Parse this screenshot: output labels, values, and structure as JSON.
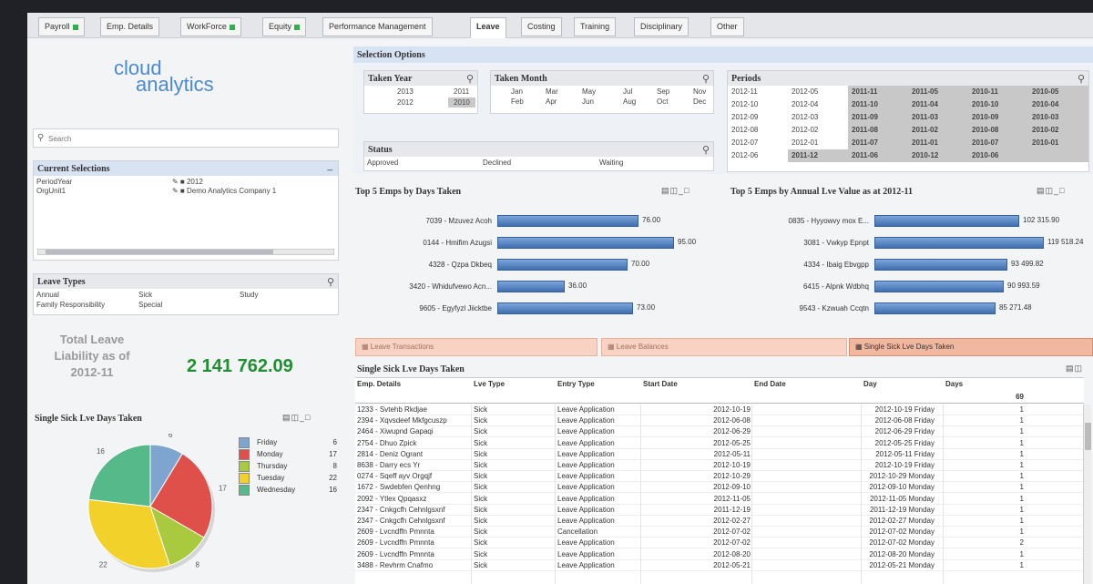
{
  "tabs": [
    {
      "label": "Payroll",
      "dot": true
    },
    {
      "label": "Emp. Details",
      "dot": false
    },
    {
      "label": "WorkForce",
      "dot": true
    },
    {
      "label": "Equity",
      "dot": true
    },
    {
      "label": "Performance Management",
      "dot": false
    },
    {
      "label": "Leave",
      "dot": false,
      "active": true
    },
    {
      "label": "Costing",
      "dot": false
    },
    {
      "label": "Training",
      "dot": false
    },
    {
      "label": "Disciplinary",
      "dot": false
    },
    {
      "label": "Other",
      "dot": false
    }
  ],
  "logo": {
    "line1": "cloud",
    "line2": "analytics"
  },
  "search": {
    "placeholder": "Search"
  },
  "current_selections": {
    "title": "Current Selections",
    "rows": [
      {
        "field": "PeriodYear",
        "value": "2012"
      },
      {
        "field": "OrgUnit1",
        "value": "Demo Analytics Company 1"
      }
    ]
  },
  "leave_types": {
    "title": "Leave Types",
    "items": [
      "Annual",
      "Sick",
      "Study",
      "Family Responsibility",
      "Special"
    ]
  },
  "liability": {
    "label_lines": [
      "Total Leave",
      "Liability as of",
      "2012-11"
    ],
    "value": "2 141 762.09"
  },
  "selection_options": {
    "title": "Selection Options",
    "taken_year": {
      "title": "Taken Year",
      "values": [
        "2013",
        "2011",
        "2012",
        "2010"
      ]
    },
    "taken_month": {
      "title": "Taken Month",
      "values": [
        "Jan",
        "Mar",
        "May",
        "Jul",
        "Sep",
        "Nov",
        "Feb",
        "Apr",
        "Jun",
        "Aug",
        "Oct",
        "Dec"
      ]
    },
    "status": {
      "title": "Status",
      "values": [
        "Approved",
        "Declined",
        "Waiting"
      ]
    },
    "periods": {
      "title": "Periods",
      "cols": [
        [
          "2012-11",
          "2012-10",
          "2012-09",
          "2012-08",
          "2012-07",
          "2012-06"
        ],
        [
          "2012-05",
          "2012-04",
          "2012-03",
          "2012-02",
          "2012-01",
          "2011-12"
        ],
        [
          "2011-11",
          "2011-10",
          "2011-09",
          "2011-08",
          "2011-07",
          "2011-06"
        ],
        [
          "2011-05",
          "2011-04",
          "2011-03",
          "2011-02",
          "2011-01",
          "2010-12"
        ],
        [
          "2010-11",
          "2010-10",
          "2010-09",
          "2010-08",
          "2010-07",
          "2010-06"
        ],
        [
          "2010-05",
          "2010-04",
          "2010-03",
          "2010-02",
          "2010-01",
          ""
        ]
      ]
    }
  },
  "top5_days": {
    "title": "Top 5 Emps by Days Taken",
    "labels": [
      "7039 - Mzuvez Acoh",
      "0144 - Hmifim Azugsi",
      "4328 - Qzpa Dkbeq",
      "3420 - Whidufvewo Acn...",
      "9605 - Egyfyzl Jiicktbe"
    ],
    "value_labels": [
      "76.00",
      "95.00",
      "70.00",
      "36.00",
      "73.00"
    ]
  },
  "top5_value": {
    "title": "Top 5 Emps by Annual Lve Value as at 2012-11",
    "labels": [
      "0835 - Hyyowvy mox E...",
      "3081 - Vwkyp Epnpt",
      "4334 - Ibaig Ebvgpp",
      "6415 - Alpnk Wdbhq",
      "9543 - Kzwuah Ccqtn"
    ],
    "value_labels": [
      "102 315.90",
      "119 518.24",
      "93 499.82",
      "90 993.59",
      "85 271.48"
    ]
  },
  "chart_data": [
    {
      "type": "bar",
      "title": "Top 5 Emps by Days Taken",
      "categories": [
        "7039 - Mzuvez Acoh",
        "0144 - Hmifim Azugsi",
        "4328 - Qzpa Dkbeq",
        "3420 - Whidufvewo Acn...",
        "9605 - Egyfyzl Jiicktbe"
      ],
      "values": [
        76,
        95,
        70,
        36,
        73
      ]
    },
    {
      "type": "bar",
      "title": "Top 5 Emps by Annual Lve Value as at 2012-11",
      "categories": [
        "0835 - Hyyowvy mox E...",
        "3081 - Vwkyp Epnpt",
        "4334 - Ibaig Ebvgpp",
        "6415 - Alpnk Wdbhq",
        "9543 - Kzwuah Ccqtn"
      ],
      "values": [
        102315.9,
        119518.24,
        93499.82,
        90993.59,
        85271.48
      ]
    },
    {
      "type": "pie",
      "title": "Single Sick Lve Days Taken",
      "categories": [
        "Friday",
        "Monday",
        "Thursday",
        "Tuesday",
        "Wednesday"
      ],
      "values": [
        6,
        17,
        8,
        22,
        16
      ],
      "colors": [
        "#7ea4d0",
        "#e0504a",
        "#a9c93e",
        "#f2d12b",
        "#55b98a"
      ]
    }
  ],
  "report_tabs": [
    "Leave Transactions",
    "Leave Balances",
    "Single Sick Lve Days Taken"
  ],
  "sick_table": {
    "title": "Single Sick Lve Days Taken",
    "headers": [
      "Emp. Details",
      "Lve Type",
      "Entry Type",
      "Start Date",
      "End Date",
      "Day",
      "Days"
    ],
    "total": "69",
    "rows": [
      [
        "1233 - Svtehb Rkdjae",
        "Sick",
        "Leave Application",
        "2012-10-19",
        "2012-10-19 Friday",
        "1"
      ],
      [
        "2394 - Xqvsdeef Mkfgcuszp",
        "Sick",
        "Leave Application",
        "2012-06-08",
        "2012-06-08 Friday",
        "1"
      ],
      [
        "2464 - Xiwupnd Gapaqi",
        "Sick",
        "Leave Application",
        "2012-06-29",
        "2012-06-29 Friday",
        "1"
      ],
      [
        "2754 - Dhuo Zpick",
        "Sick",
        "Leave Application",
        "2012-05-25",
        "2012-05-25 Friday",
        "1"
      ],
      [
        "2814 - Deniz Ogrant",
        "Sick",
        "Leave Application",
        "2012-05-11",
        "2012-05-11 Friday",
        "1"
      ],
      [
        "8638 - Darry ecs Yr",
        "Sick",
        "Leave Application",
        "2012-10-19",
        "2012-10-19 Friday",
        "1"
      ],
      [
        "0274 - Sqeff ayv Orgqjf",
        "Sick",
        "Leave Application",
        "2012-10-29",
        "2012-10-29 Monday",
        "1"
      ],
      [
        "1672 - Swdebfen Qenhng",
        "Sick",
        "Leave Application",
        "2012-09-10",
        "2012-09-10 Monday",
        "1"
      ],
      [
        "2092 - Ytlex Qpqasxz",
        "Sick",
        "Leave Application",
        "2012-11-05",
        "2012-11-05 Monday",
        "1"
      ],
      [
        "2347 - Cnkgcfh Cehnlgsxnf",
        "Sick",
        "Leave Application",
        "2011-12-19",
        "2011-12-19 Monday",
        "1"
      ],
      [
        "2347 - Cnkgcfh Cehnlgsxnf",
        "Sick",
        "Leave Application",
        "2012-02-27",
        "2012-02-27 Monday",
        "1"
      ],
      [
        "2609 - Lvcndffn Pmnnta",
        "Sick",
        "Cancellation",
        "2012-07-02",
        "2012-07-02 Monday",
        "1"
      ],
      [
        "2609 - Lvcndffn Pmnnta",
        "Sick",
        "Leave Application",
        "2012-07-02",
        "2012-07-02 Monday",
        "2"
      ],
      [
        "2609 - Lvcndffn Pmnnta",
        "Sick",
        "Leave Application",
        "2012-08-20",
        "2012-08-20 Monday",
        "1"
      ],
      [
        "3488 - Revhrm Cnafmo",
        "Sick",
        "Leave Application",
        "2012-05-21",
        "2012-05-21 Monday",
        "1"
      ]
    ]
  }
}
